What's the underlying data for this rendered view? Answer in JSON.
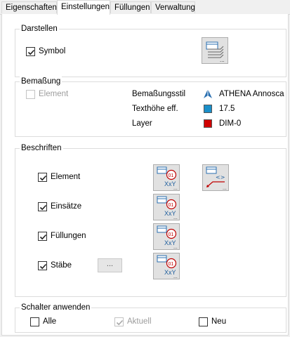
{
  "tabs": [
    {
      "label": "Eigenschaften"
    },
    {
      "label": "Einstellungen"
    },
    {
      "label": "Füllungen"
    },
    {
      "label": "Verwaltung"
    }
  ],
  "active_tab": "Einstellungen",
  "darstellen": {
    "title": "Darstellen",
    "symbol_label": "Symbol",
    "symbol_checked": true
  },
  "bemassung": {
    "title": "Bemaßung",
    "element_label": "Element",
    "element_checked": false,
    "stil_label": "Bemaßungsstil",
    "stil_value": "ATHENA Annosca",
    "texthoehe_label": "Texthöhe eff.",
    "texthoehe_value": "17.5",
    "texthoehe_color": "#1a8fc9",
    "layer_label": "Layer",
    "layer_value": "DIM-0",
    "layer_color": "#d00000"
  },
  "beschriften": {
    "title": "Beschriften",
    "items": [
      {
        "label": "Element",
        "checked": true
      },
      {
        "label": "Einsätze",
        "checked": true
      },
      {
        "label": "Füllungen",
        "checked": true
      },
      {
        "label": "Stäbe",
        "checked": true
      }
    ],
    "dots_label": "..."
  },
  "schalter": {
    "title": "Schalter anwenden",
    "alle_label": "Alle",
    "alle_checked": false,
    "aktuell_label": "Aktuell",
    "aktuell_checked": true,
    "neu_label": "Neu",
    "neu_checked": false
  },
  "icons": {
    "label_icon_text_top": "01",
    "label_icon_text_bottom": "XxY",
    "ellipsis": "..."
  }
}
